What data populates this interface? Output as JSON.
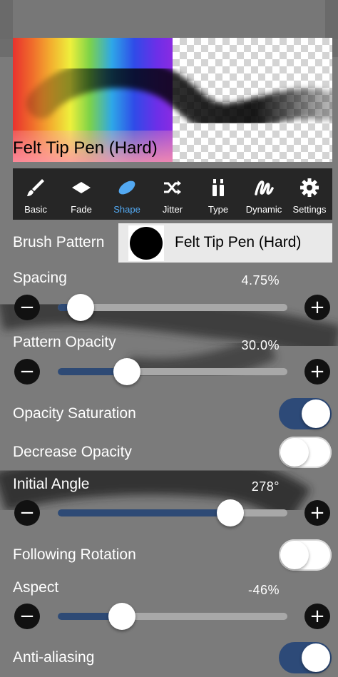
{
  "preview": {
    "label": "Felt Tip Pen (Hard)"
  },
  "tabs": [
    {
      "label": "Basic",
      "icon": "brush-icon"
    },
    {
      "label": "Fade",
      "icon": "diamond-icon"
    },
    {
      "label": "Shape",
      "icon": "ellipse-icon",
      "active": true
    },
    {
      "label": "Jitter",
      "icon": "shuffle-icon"
    },
    {
      "label": "Type",
      "icon": "tubes-icon"
    },
    {
      "label": "Dynamic",
      "icon": "scribble-icon"
    },
    {
      "label": "Settings",
      "icon": "gear-icon"
    }
  ],
  "brush_pattern": {
    "label": "Brush Pattern",
    "name": "Felt Tip Pen (Hard)"
  },
  "spacing": {
    "label": "Spacing",
    "value": "4.75%",
    "level": 0.1
  },
  "pattern_opacity": {
    "label": "Pattern Opacity",
    "value": "30.0%",
    "level": 0.3
  },
  "opacity_saturation": {
    "label": "Opacity Saturation",
    "on": true
  },
  "decrease_opacity": {
    "label": "Decrease Opacity",
    "on": false
  },
  "initial_angle": {
    "label": "Initial Angle",
    "value": "278°",
    "level": 0.75
  },
  "following_rotation": {
    "label": "Following Rotation",
    "on": false
  },
  "aspect": {
    "label": "Aspect",
    "value": "-46%",
    "level": 0.28
  },
  "anti_aliasing": {
    "label": "Anti-aliasing",
    "on": true
  },
  "buttons": {
    "minus": "−",
    "plus": "+"
  },
  "colors": {
    "accent": "#53a9f2",
    "fill": "#2e4a75",
    "toggle_on": "#2d4a78"
  }
}
